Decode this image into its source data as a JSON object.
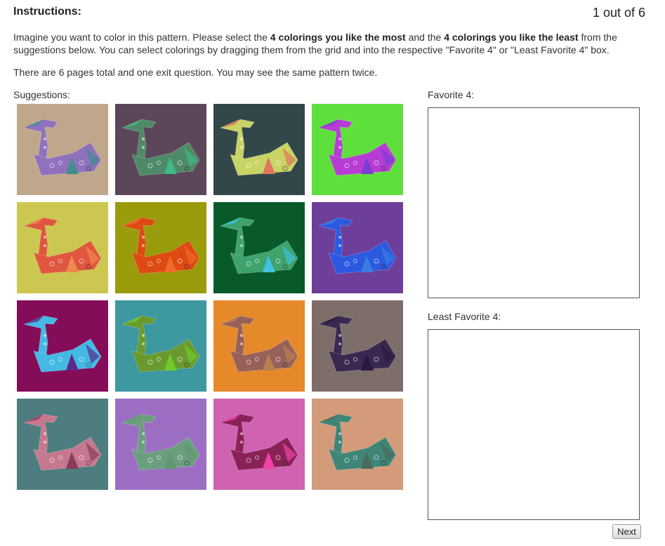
{
  "header": {
    "title": "Instructions:",
    "progress": "1 out of 6"
  },
  "instructions": {
    "p1_a": "Imagine you want to color in this pattern. Please select the ",
    "p1_b1": "4 colorings you like the most",
    "p1_c": " and the ",
    "p1_b2": "4 colorings you like the least",
    "p1_d": " from the suggestions below. You can select colorings by dragging them from the grid and into the respective \"Favorite 4\" or \"Least Favorite 4\" box.",
    "p2": "There are 6 pages total and one exit question. You may see the same pattern twice."
  },
  "suggestions_label": "Suggestions:",
  "favorite_label": "Favorite 4:",
  "least_favorite_label": "Least Favorite 4:",
  "next_label": "Next",
  "tiles": [
    {
      "bg": "#bfa78b",
      "body": "#8f71bd",
      "accent": "#3f8f8b"
    },
    {
      "bg": "#5b4759",
      "body": "#4f8a67",
      "accent": "#3fb98a"
    },
    {
      "bg": "#33474a",
      "body": "#c8d463",
      "accent": "#e0755d"
    },
    {
      "bg": "#5edf3c",
      "body": "#b63cd4",
      "accent": "#7d3cd4"
    },
    {
      "bg": "#ccc750",
      "body": "#e0563f",
      "accent": "#ef8a4f"
    },
    {
      "bg": "#9a9b0a",
      "body": "#de4a12",
      "accent": "#f06a2a"
    },
    {
      "bg": "#085a2a",
      "body": "#3fa36e",
      "accent": "#3fc3e0"
    },
    {
      "bg": "#6e3e9b",
      "body": "#2b59e0",
      "accent": "#3a7de0"
    },
    {
      "bg": "#840c58",
      "body": "#44b9e4",
      "accent": "#5a2a8a"
    },
    {
      "bg": "#3d989f",
      "body": "#6a9a2f",
      "accent": "#6fca2a"
    },
    {
      "bg": "#e6892a",
      "body": "#97615a",
      "accent": "#b8804f"
    },
    {
      "bg": "#7e6e6a",
      "body": "#3a2850",
      "accent": "#2a1a40"
    },
    {
      "bg": "#4d7d7e",
      "body": "#c6788e",
      "accent": "#8a3a5a"
    },
    {
      "bg": "#9b6ec3",
      "body": "#6a9e7e",
      "accent": "#5c9a6e"
    },
    {
      "bg": "#cf63b2",
      "body": "#8a2258",
      "accent": "#f041a6"
    },
    {
      "bg": "#d39b7a",
      "body": "#3f8578",
      "accent": "#4a6b5e"
    }
  ]
}
